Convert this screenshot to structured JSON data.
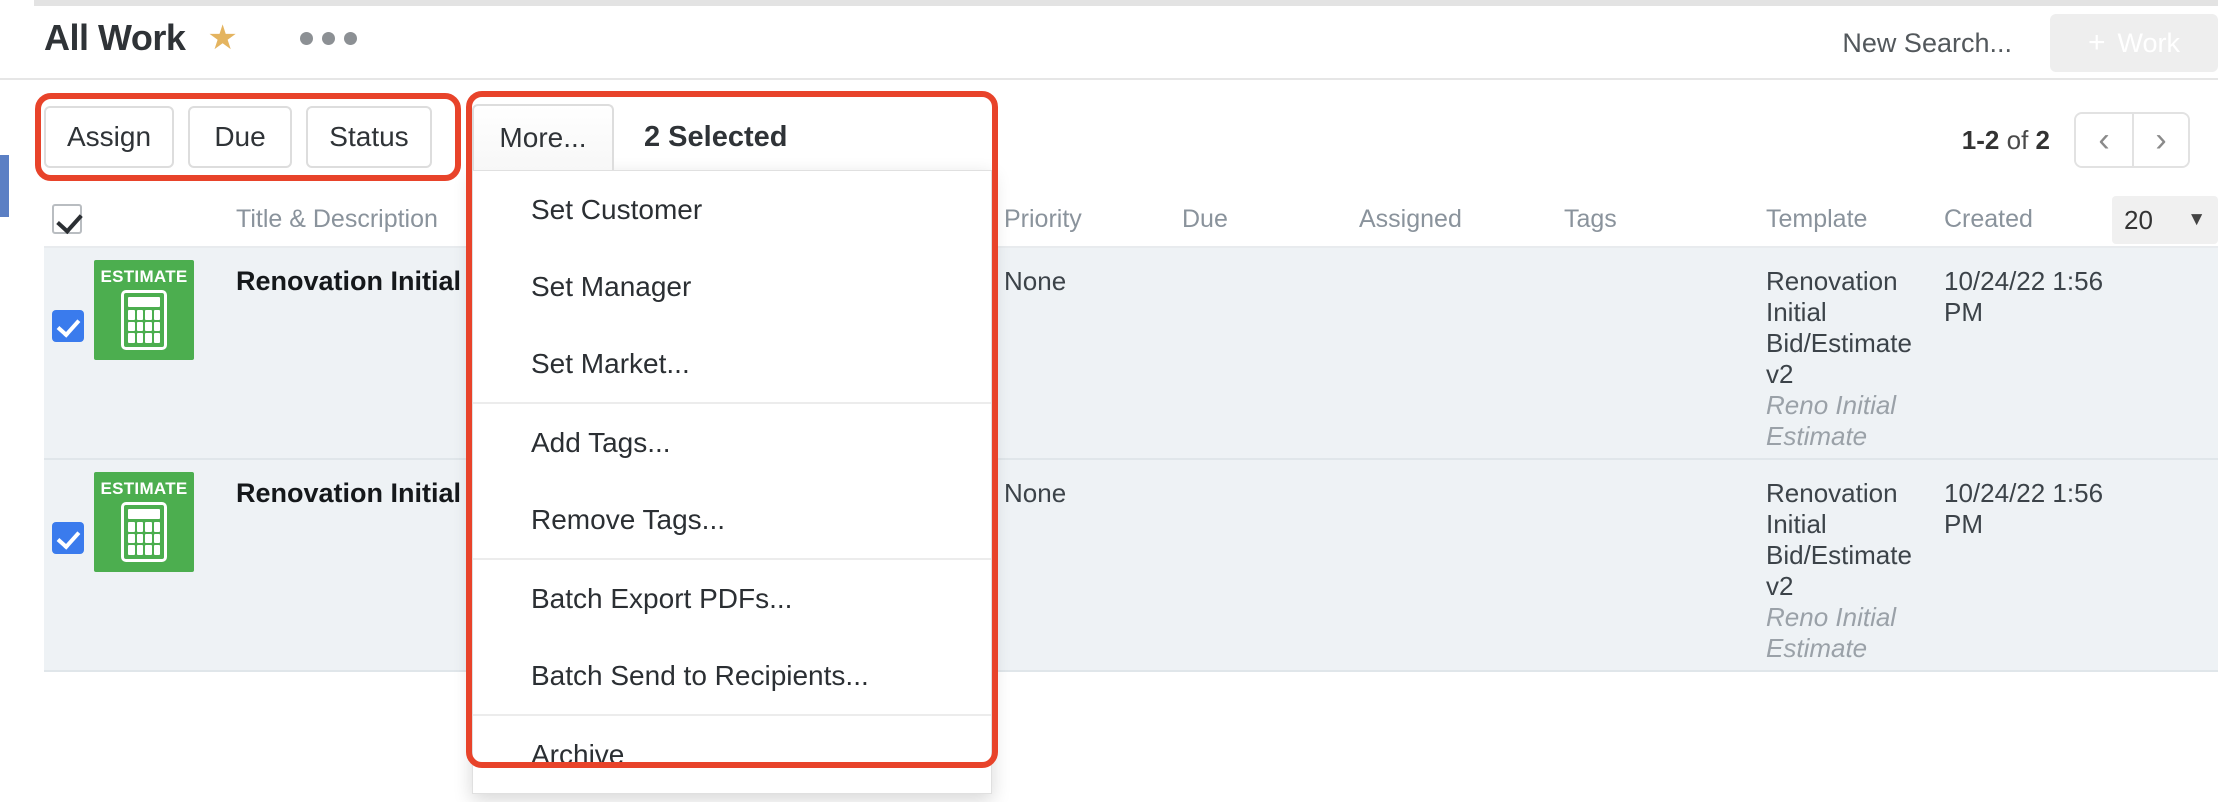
{
  "header": {
    "title": "All Work",
    "star_icon": "star-icon",
    "overflow_icon": "ellipsis-icon",
    "search_label": "New Search...",
    "work_button": {
      "plus": "+",
      "label": "Work"
    }
  },
  "toolbar": {
    "buttons": [
      {
        "label": "Assign",
        "name": "assign"
      },
      {
        "label": "Due",
        "name": "due"
      },
      {
        "label": "Status",
        "name": "status"
      }
    ],
    "more_label": "More...",
    "selected_label": "2 Selected"
  },
  "more_menu": {
    "groups": [
      {
        "items": [
          "Set Customer",
          "Set Manager",
          "Set Market..."
        ]
      },
      {
        "items": [
          "Add Tags...",
          "Remove Tags..."
        ]
      },
      {
        "items": [
          "Batch Export PDFs...",
          "Batch Send to Recipients..."
        ]
      },
      {
        "items": [
          "Archive"
        ]
      }
    ]
  },
  "pager": {
    "range_start": "1",
    "dash": "-",
    "range_end": "2",
    "of": "of",
    "total": "2",
    "prev_icon": "‹",
    "next_icon": "›"
  },
  "table": {
    "headers": {
      "title": "Title & Description",
      "priority": "Priority",
      "due": "Due",
      "assigned": "Assigned",
      "tags": "Tags",
      "template": "Template",
      "created": "Created"
    },
    "page_size": {
      "value": "20",
      "caret": "▼"
    },
    "rows": [
      {
        "checked": true,
        "icon_label": "ESTIMATE",
        "title": "Renovation Initial Bid,",
        "priority": "None",
        "due": "",
        "assigned": "",
        "tags": "",
        "template": "Renovation Initial Bid/Estimate v2",
        "template_sub": "Reno Initial Estimate",
        "created": "10/24/22 1:56 PM"
      },
      {
        "checked": true,
        "icon_label": "ESTIMATE",
        "title": "Renovation Initial Bid,",
        "priority": "None",
        "due": "",
        "assigned": "",
        "tags": "",
        "template": "Renovation Initial Bid/Estimate v2",
        "template_sub": "Reno Initial Estimate",
        "created": "10/24/22 1:56 PM"
      }
    ]
  },
  "colors": {
    "highlight": "#e8432a",
    "accent_blue": "#5b7fc4",
    "checkbox_blue": "#3a7bed",
    "estimate_green": "#4cae4f",
    "star_gold": "#e4b460",
    "row_bg": "#eef2f5"
  }
}
